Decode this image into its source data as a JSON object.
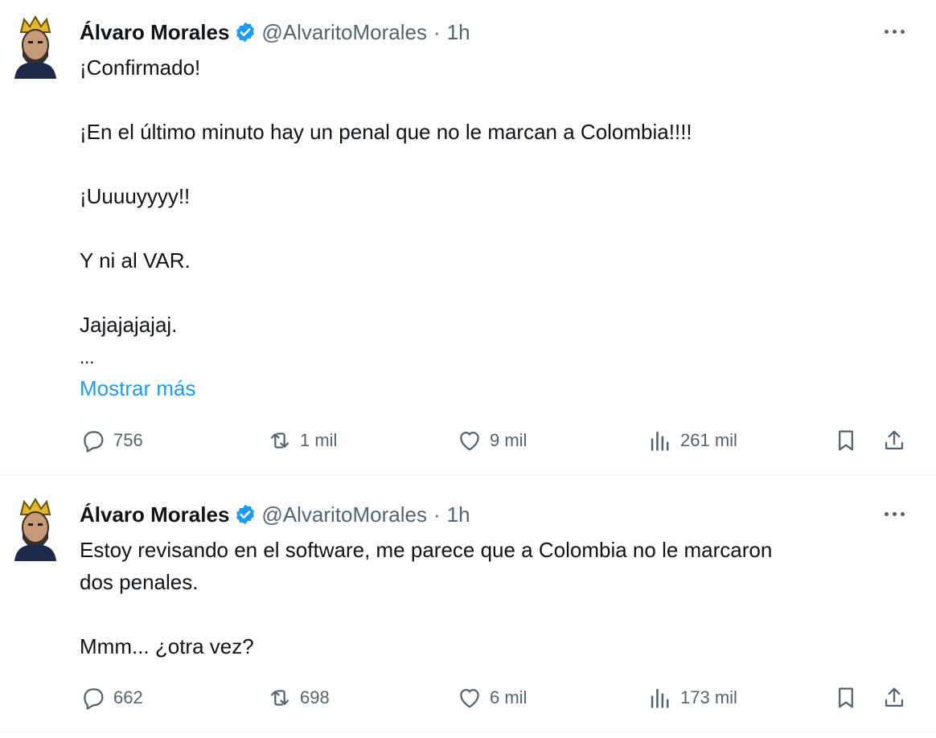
{
  "colors": {
    "text": "#0f1419",
    "secondary": "#536471",
    "link": "#1d9bf0",
    "verified": "#1d9bf0",
    "divider": "#eff3f4"
  },
  "tweets": [
    {
      "author": {
        "name": "Álvaro Morales",
        "handle": "@AlvaritoMorales",
        "separator": "·",
        "time": "1h",
        "avatar_icon": "avatar-crowned-man",
        "verified_icon": "verified-badge-icon"
      },
      "text_lines": [
        "¡Confirmado!",
        "",
        "¡En el último minuto hay un penal que no le marcan a Colombia!!!!",
        "",
        "¡Uuuuyyyy!!",
        "",
        "Y ni al VAR.",
        "",
        "Jajajajajaj."
      ],
      "truncation": "...",
      "show_more_label": "Mostrar más",
      "stats": {
        "replies": "756",
        "reposts": "1 mil",
        "likes": "9 mil",
        "views": "261 mil"
      }
    },
    {
      "author": {
        "name": "Álvaro Morales",
        "handle": "@AlvaritoMorales",
        "separator": "·",
        "time": "1h",
        "avatar_icon": "avatar-crowned-man",
        "verified_icon": "verified-badge-icon"
      },
      "text_lines": [
        "Estoy revisando en el software, me parece que a Colombia no le marcaron",
        "dos penales.",
        "",
        "Mmm... ¿otra vez?"
      ],
      "stats": {
        "replies": "662",
        "reposts": "698",
        "likes": "6 mil",
        "views": "173 mil"
      }
    }
  ]
}
